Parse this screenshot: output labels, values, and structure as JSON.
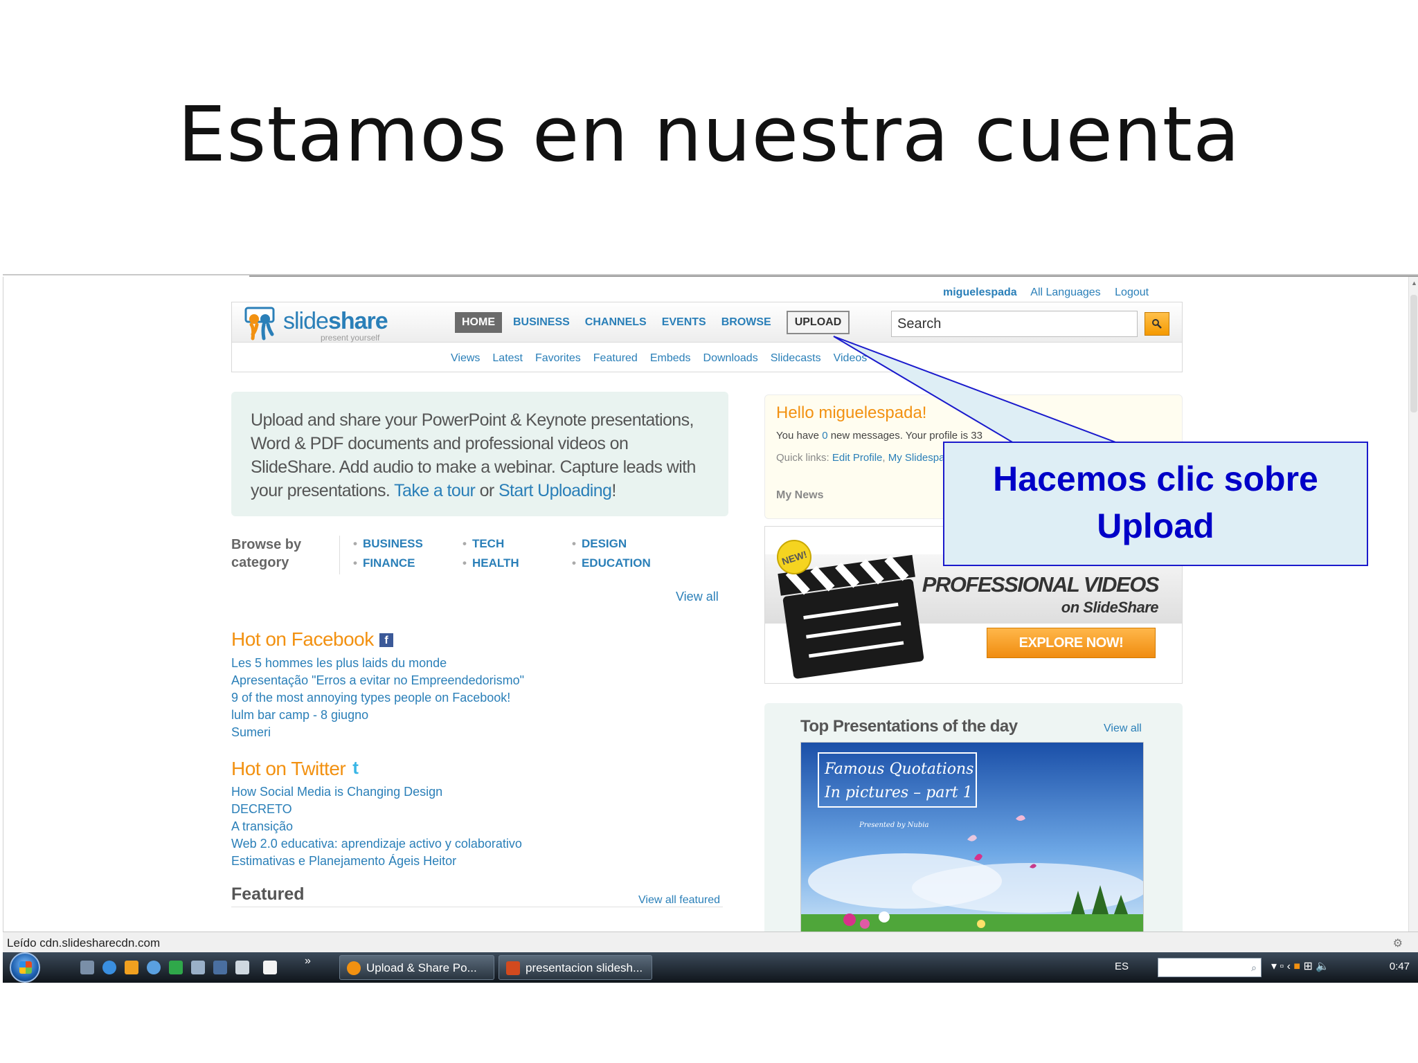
{
  "slide_title": "Estamos en nuestra cuenta",
  "userbar": {
    "username": "miguelespada",
    "languages": "All Languages",
    "logout": "Logout"
  },
  "logo": {
    "text_a": "slide",
    "text_b": "share",
    "tagline": "present yourself"
  },
  "nav": {
    "home": "HOME",
    "business": "BUSINESS",
    "channels": "CHANNELS",
    "events": "EVENTS",
    "browse": "BROWSE",
    "upload": "UPLOAD"
  },
  "search": {
    "placeholder": "Search"
  },
  "subnav": [
    "Views",
    "Latest",
    "Favorites",
    "Featured",
    "Embeds",
    "Downloads",
    "Slidecasts",
    "Videos"
  ],
  "intro": {
    "text": "Upload and share your PowerPoint & Keynote presentations, Word & PDF documents and professional videos on SlideShare. Add audio to make a webinar. Capture leads with your presentations.",
    "link_tour": "Take a tour",
    "or": "or",
    "link_upload": "Start Uploading",
    "end": "!"
  },
  "browse": {
    "label": "Browse by category",
    "categories": [
      "BUSINESS",
      "FINANCE",
      "TECH",
      "HEALTH",
      "DESIGN",
      "EDUCATION"
    ],
    "view_all": "View all"
  },
  "hot_facebook": {
    "title": "Hot on Facebook",
    "items": [
      "Les 5 hommes les plus laids du monde",
      "Apresentação \"Erros a evitar no Empreendedorismo\"",
      "9 of the most annoying types people on Facebook!",
      "lulm bar camp - 8 giugno",
      "Sumeri"
    ]
  },
  "hot_twitter": {
    "title": "Hot on Twitter",
    "items": [
      "How Social Media is Changing Design",
      "DECRETO",
      "A transição",
      "Web 2.0 educativa: aprendizaje activo y colaborativo",
      "Estimativas e Planejamento Ágeis Heitor"
    ]
  },
  "featured": {
    "title": "Featured",
    "view_all": "View all featured"
  },
  "hello": {
    "title": "Hello miguelespada!",
    "msg_a": "You have ",
    "msg_count": "0",
    "msg_b": " new messages. Your profile is 33",
    "quick_label": "Quick links: ",
    "quick_edit": "Edit Profile",
    "quick_sep": ", ",
    "quick_my": "My Slidespa",
    "news": "My News"
  },
  "promo": {
    "badge": "NEW!",
    "title": "PROFESSIONAL VIDEOS",
    "subtitle": "on SlideShare",
    "button": "EXPLORE NOW!"
  },
  "top_presentations": {
    "title": "Top Presentations of the day",
    "view_all": "View all",
    "thumb_line1": "Famous Quotations",
    "thumb_line2": "In pictures – part 1",
    "thumb_credit": "Presented by Nubia"
  },
  "callout": {
    "line1": "Hacemos clic sobre",
    "line2": "Upload"
  },
  "statusbar": {
    "text": "Leído cdn.slidesharecdn.com"
  },
  "taskbar": {
    "task1": "Upload & Share Po...",
    "task2": "presentacion slidesh...",
    "lang": "ES",
    "clock": "0:47"
  },
  "colors": {
    "brand_blue": "#2a7fb8",
    "brand_orange": "#f29111",
    "callout_blue": "#0000c8"
  }
}
